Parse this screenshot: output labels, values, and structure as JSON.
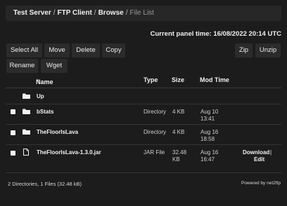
{
  "breadcrumb": {
    "items": [
      "Test Server",
      "FTP Client",
      "Browse"
    ],
    "current": "File List",
    "separator": "/"
  },
  "panel_time": "Current panel time: 16/08/2022 20:14 UTC",
  "toolbar": {
    "select_all": "Select All",
    "move": "Move",
    "delete": "Delete",
    "copy": "Copy",
    "zip": "Zip",
    "unzip": "Unzip",
    "rename": "Rename",
    "wget": "Wget"
  },
  "table": {
    "headers": {
      "name": "Name",
      "sort_indicator": "▲",
      "type": "Type",
      "size": "Size",
      "mod_time": "Mod Time"
    },
    "up_label": "Up",
    "rows": [
      {
        "name": "bStats",
        "type": "Directory",
        "size": "4 KB",
        "mod_line1": "Aug 10",
        "mod_line2": "13:41",
        "icon": "folder-icon"
      },
      {
        "name": "TheFloorIsLava",
        "type": "Directory",
        "size": "4 KB",
        "mod_line1": "Aug 16",
        "mod_line2": "18:58",
        "icon": "folder-icon"
      },
      {
        "name": "TheFloorIsLava-1.3.0.jar",
        "type": "JAR File",
        "size_line1": "32.48",
        "size_line2": "KB",
        "mod_line1": "Aug 16",
        "mod_line2": "16:47",
        "icon": "file-icon",
        "actions": {
          "download": "Download",
          "separator": "|",
          "edit": "Edit"
        }
      }
    ]
  },
  "footer": {
    "summary": "2 Directories, 1 Files (32.48 kB)",
    "powered_by": "Powered by net2ftp"
  }
}
